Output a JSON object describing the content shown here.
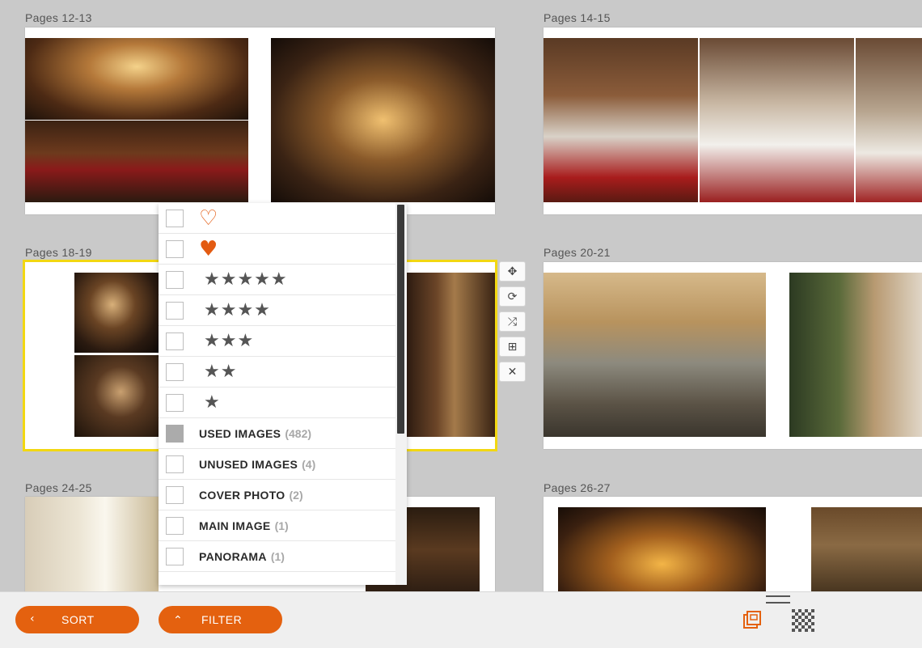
{
  "spreads": [
    {
      "label": "Pages 12-13"
    },
    {
      "label": "Pages 14-15"
    },
    {
      "label": "Pages 18-19"
    },
    {
      "label": "Pages 20-21"
    },
    {
      "label": "Pages 24-25"
    },
    {
      "label": "Pages 26-27"
    }
  ],
  "spread_actions": [
    {
      "name": "move-icon",
      "glyph": "✥"
    },
    {
      "name": "rotate-icon",
      "glyph": "⟳"
    },
    {
      "name": "shuffle-icon",
      "glyph": "⤮"
    },
    {
      "name": "grid-layout-icon",
      "glyph": "⊞"
    },
    {
      "name": "close-icon",
      "glyph": "✕"
    }
  ],
  "filter": {
    "hearts": [
      {
        "glyph": "♡",
        "checked": false
      },
      {
        "glyph": "♥",
        "checked": false
      }
    ],
    "stars": [
      {
        "glyph": "★★★★★",
        "checked": false
      },
      {
        "glyph": "★★★★",
        "checked": false
      },
      {
        "glyph": "★★★",
        "checked": false
      },
      {
        "glyph": "★★",
        "checked": false
      },
      {
        "glyph": "★",
        "checked": false
      }
    ],
    "categories": [
      {
        "label": "USED IMAGES",
        "count": "(482)",
        "checked": true
      },
      {
        "label": "UNUSED IMAGES",
        "count": "(4)",
        "checked": false
      },
      {
        "label": "COVER PHOTO",
        "count": "(2)",
        "checked": false
      },
      {
        "label": "MAIN IMAGE",
        "count": "(1)",
        "checked": false
      },
      {
        "label": "PANORAMA",
        "count": "(1)",
        "checked": false
      }
    ]
  },
  "bottombar": {
    "sort_label": "SORT",
    "sort_chevron": "‹",
    "filter_label": "FILTER",
    "filter_chevron": "⌃"
  },
  "colors": {
    "accent": "#e4610f",
    "selection": "#f2d712",
    "background": "#c9c9c9"
  }
}
